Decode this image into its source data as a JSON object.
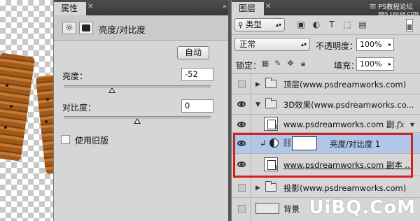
{
  "properties": {
    "tab_title": "属性",
    "tab_close": "✕",
    "collapse": "»",
    "header_title": "亮度/对比度",
    "auto_button": "自动",
    "brightness_label": "亮度：",
    "brightness_value": "-52",
    "brightness_slider_fraction": 0.33,
    "contrast_label": "对比度：",
    "contrast_value": "0",
    "contrast_slider_fraction": 0.5,
    "legacy_label": "使用旧版",
    "legacy_checked": false
  },
  "layers": {
    "tab_title": "图层",
    "tab_close": "✕",
    "menu_icon": "≡",
    "filter_kind": "类型",
    "blend_mode": "正常",
    "opacity_label": "不透明度：",
    "opacity_value": "100%",
    "lock_label": "锁定：",
    "fill_label": "填充：",
    "fill_value": "100%",
    "rows": [
      {
        "name": "顶层(www.psdreamworks.com)",
        "visible": false
      },
      {
        "name": "3D效果(www.psdreamworks.co...",
        "visible": true
      },
      {
        "name": "www.psdreamworks.com 副...",
        "visible": true
      },
      {
        "name": "亮度/对比度 1",
        "visible": true,
        "selected": true
      },
      {
        "name": "www.psdreamworks.com 副本 ...",
        "visible": true
      },
      {
        "name": "投影(www.psdreamworks.com)",
        "visible": false
      },
      {
        "name": "背景",
        "visible": false
      }
    ]
  },
  "colors": {
    "selected_row": "#b0c7ea",
    "highlight_border": "#d61f1f",
    "panel_bg": "#d6d6d6"
  },
  "watermarks": {
    "top": "PS教程论坛",
    "top_sub": "BBS.16XX8.COM",
    "bottom": "UiBQ.CoM"
  }
}
